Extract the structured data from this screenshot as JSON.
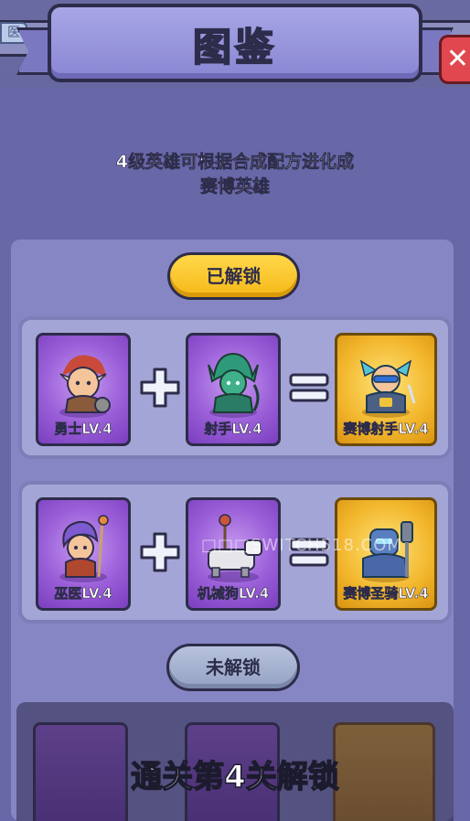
{
  "window": {
    "title": "图鉴",
    "back_chip": "医"
  },
  "header": {
    "subtitle_line1": "4级英雄可根据合成配方进化成",
    "subtitle_line2": "赛博英雄"
  },
  "sections": {
    "unlocked_label": "已解锁",
    "locked_label": "未解锁"
  },
  "recipes": [
    {
      "ingredient_a": "勇士LV.4",
      "ingredient_b": "射手LV.4",
      "result": "赛博射手LV.4"
    },
    {
      "ingredient_a": "巫医LV.4",
      "ingredient_b": "机械狗LV.4",
      "result": "赛博圣骑LV.4"
    }
  ],
  "locked": {
    "caption": "通关第4关解锁"
  },
  "watermark": "□□□SWITCH518.COM",
  "colors": {
    "panel": "#6867a8",
    "gold_pill": "#f5b818",
    "gray_pill": "#94a1c2",
    "purple_card": "#9a5ed8",
    "gold_card": "#f2b62c",
    "close": "#e0474e"
  }
}
